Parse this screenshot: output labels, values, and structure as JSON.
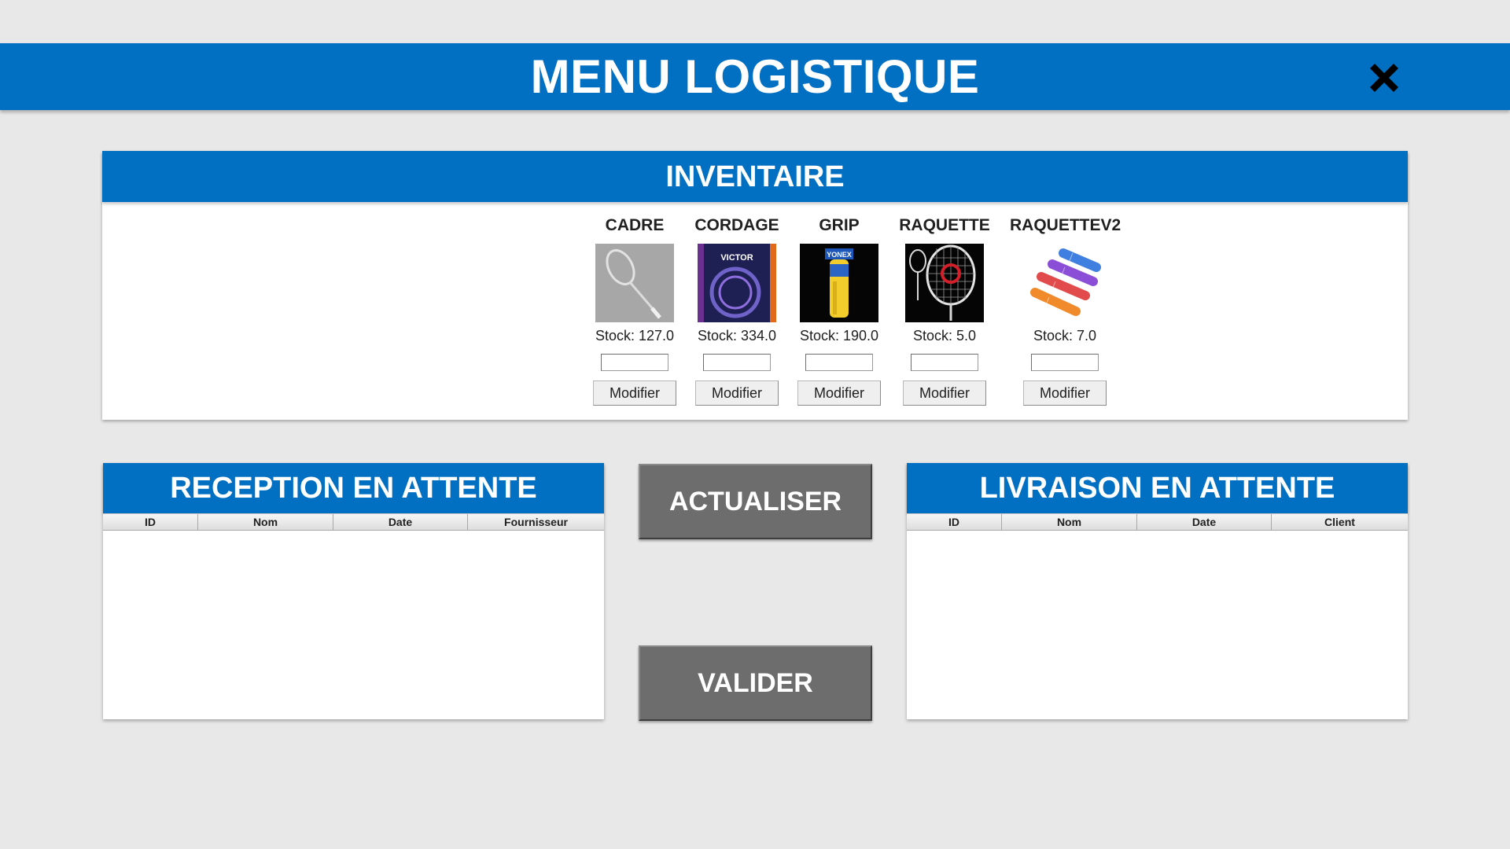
{
  "header": {
    "title": "MENU LOGISTIQUE",
    "close_icon": "close-icon"
  },
  "inventory": {
    "title": "INVENTAIRE",
    "products": [
      {
        "name": "CADRE",
        "stock": "Stock: 127.0",
        "image": "racket-frame-icon",
        "input_value": "",
        "button_label": "Modifier"
      },
      {
        "name": "CORDAGE",
        "stock": "Stock: 334.0",
        "image": "string-pack-icon",
        "input_value": "",
        "button_label": "Modifier"
      },
      {
        "name": "GRIP",
        "stock": "Stock: 190.0",
        "image": "grip-roll-icon",
        "input_value": "",
        "button_label": "Modifier"
      },
      {
        "name": "RAQUETTE",
        "stock": "Stock: 5.0",
        "image": "racket-icon",
        "input_value": "",
        "button_label": "Modifier"
      },
      {
        "name": "RAQUETTEV2",
        "stock": "Stock: 7.0",
        "image": "grips-bundle-icon",
        "input_value": "",
        "button_label": "Modifier"
      }
    ],
    "image_text": {
      "cordage_brand": "VICTOR",
      "grip_brand": "YONEX"
    }
  },
  "reception": {
    "title": "RECEPTION EN ATTENTE",
    "columns": [
      "ID",
      "Nom",
      "Date",
      "Fournisseur"
    ],
    "rows": []
  },
  "livraison": {
    "title": "LIVRAISON EN ATTENTE",
    "columns": [
      "ID",
      "Nom",
      "Date",
      "Client"
    ],
    "rows": []
  },
  "actions": {
    "refresh_label": "ACTUALISER",
    "validate_label": "VALIDER"
  },
  "colors": {
    "accent": "#0170c3",
    "background": "#e8e8e8",
    "action_button": "#6d6d6d"
  }
}
